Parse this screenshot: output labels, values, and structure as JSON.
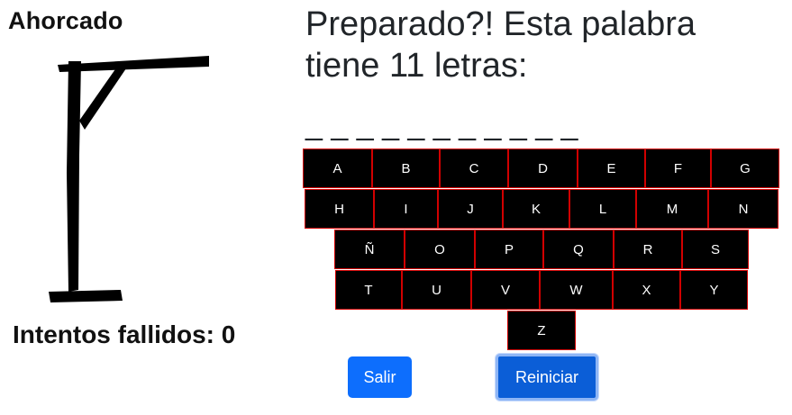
{
  "game": {
    "title": "Ahorcado",
    "fails_label": "Intentos fallidos: 0",
    "prompt": "Preparado?! Esta palabra tiene 11 letras:",
    "word_display": "_ _ _ _ _ _ _ _ _ _ _"
  },
  "keyboard": {
    "rows": [
      [
        "A",
        "B",
        "C",
        "D",
        "E",
        "F",
        "G"
      ],
      [
        "H",
        "I",
        "J",
        "K",
        "L",
        "M",
        "N"
      ],
      [
        "Ñ",
        "O",
        "P",
        "Q",
        "R",
        "S"
      ],
      [
        "T",
        "U",
        "V",
        "W",
        "X",
        "Y"
      ],
      [
        "Z"
      ]
    ]
  },
  "buttons": {
    "exit_label": "Salir",
    "reset_label": "Reiniciar"
  },
  "colors": {
    "key_background": "#000000",
    "key_border": "#d10000",
    "primary": "#0d6efd"
  }
}
